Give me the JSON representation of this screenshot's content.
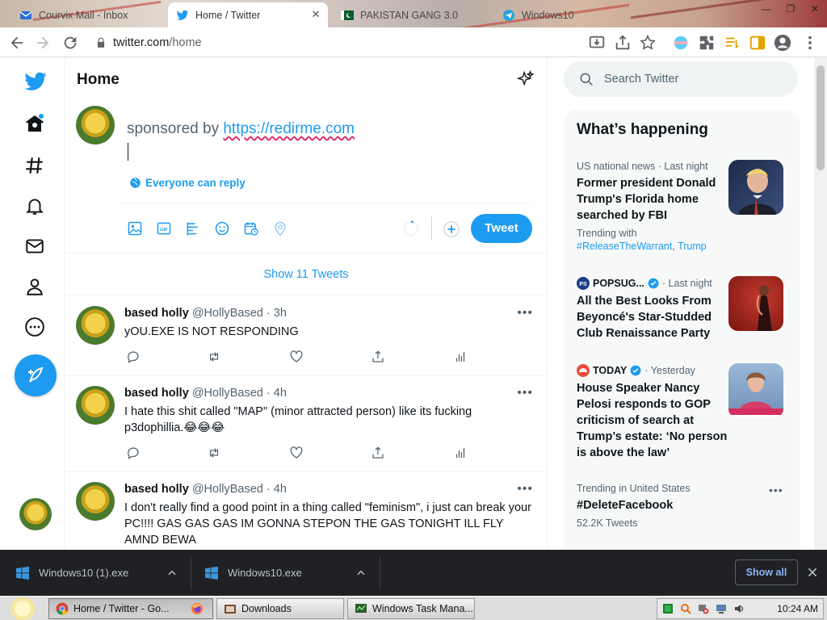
{
  "browser": {
    "tabs": [
      {
        "title": "Courvix Mail - Inbox",
        "active": false
      },
      {
        "title": "Home / Twitter",
        "active": true
      },
      {
        "title": "PAKISTAN GANG 3.0",
        "active": false
      },
      {
        "title": "Windows10",
        "active": false
      }
    ],
    "url_host": "twitter.com",
    "url_path": "/home"
  },
  "twitter": {
    "header_title": "Home",
    "compose": {
      "text_prefix": "sponsored by ",
      "link_text": "https://redirme.com",
      "reply_setting": "Everyone can reply",
      "tweet_button": "Tweet"
    },
    "show_tweets_label": "Show 11 Tweets",
    "tweets": [
      {
        "name": "based holly",
        "handle": "@HollyBased",
        "time": "3h",
        "text": "yOU.EXE IS NOT RESPONDING"
      },
      {
        "name": "based holly",
        "handle": "@HollyBased",
        "time": "4h",
        "text": "I hate this shit called \"MAP\" (minor attracted person) like its fucking p3dophillia.😂😂😂"
      },
      {
        "name": "based holly",
        "handle": "@HollyBased",
        "time": "4h",
        "text": "I don't really find a good point in a thing called \"feminism\", i just can break your PC!!!! GAS GAS GAS IM GONNA STEPON THE GAS TONIGHT ILL FLY AMND BEWA"
      }
    ],
    "search_placeholder": "Search Twitter",
    "trends_title": "What’s happening",
    "trends": [
      {
        "meta": "US national news · Last night",
        "headline": "Former president Donald Trump's Florida home searched by FBI",
        "sub_prefix": "Trending with",
        "tag1": "#ReleaseTheWarrant",
        "tag2": "Trump"
      },
      {
        "source": "POPSUG...",
        "meta": "· Last night",
        "headline": "All the Best Looks From Beyoncé's Star-Studded Club Renaissance Party"
      },
      {
        "source": "TODAY",
        "meta": "· Yesterday",
        "headline": "House Speaker Nancy Pelosi responds to GOP criticism of search at Trump’s estate: ‘No person is above the law’"
      },
      {
        "meta": "Trending in United States",
        "headline": "#DeleteFacebook",
        "sub": "52.2K Tweets"
      }
    ]
  },
  "downloads": {
    "items": [
      {
        "name": "Windows10 (1).exe"
      },
      {
        "name": "Windows10.exe"
      }
    ],
    "show_all": "Show all"
  },
  "taskbar": {
    "buttons": [
      {
        "label": "Home / Twitter - Go...",
        "active": true
      },
      {
        "label": "",
        "active": false
      },
      {
        "label": "Downloads",
        "active": false
      },
      {
        "label": "Windows Task Mana...",
        "active": false
      }
    ],
    "clock": "10:24 AM"
  },
  "colors": {
    "twitter_blue": "#1d9bf0",
    "dl_bar_bg": "#202124"
  }
}
